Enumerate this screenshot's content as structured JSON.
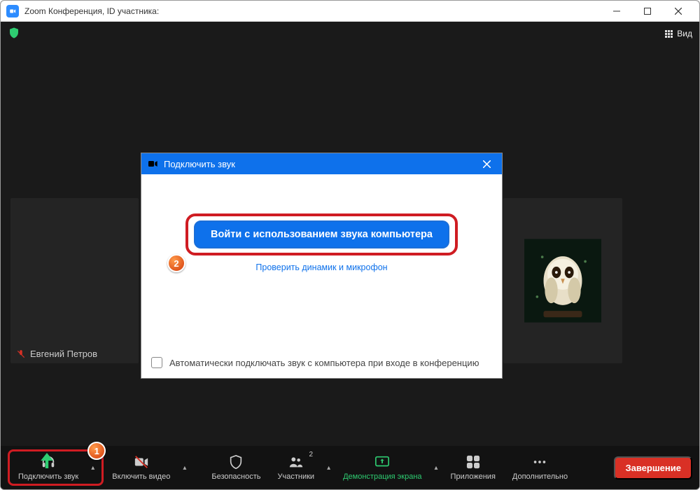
{
  "titlebar": {
    "title": "Zoom Конференция, ID участника:"
  },
  "topbar": {
    "view_label": "Вид"
  },
  "participants": {
    "left_name": "Евгений Петров"
  },
  "modal": {
    "title": "Подключить звук",
    "primary_button": "Войти с использованием звука компьютера",
    "test_link": "Проверить динамик и микрофон",
    "auto_join_label": "Автоматически подключать звук с компьютера при входе в конференцию"
  },
  "bottombar": {
    "join_audio": "Подключить звук",
    "start_video": "Включить видео",
    "security": "Безопасность",
    "participants": "Участники",
    "participants_count": "2",
    "share_screen": "Демонстрация экрана",
    "apps": "Приложения",
    "more": "Дополнительно",
    "end": "Завершение"
  },
  "annotations": {
    "step1": "1",
    "step2": "2"
  }
}
